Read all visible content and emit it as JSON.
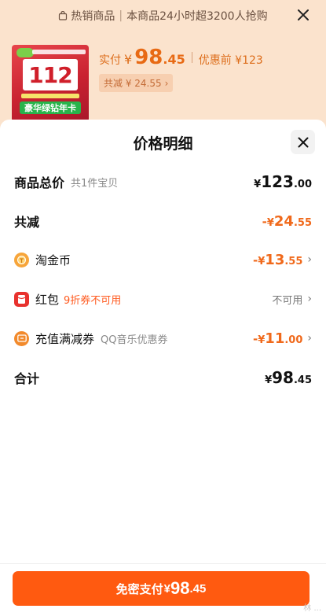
{
  "background": {
    "topbar": {
      "hot_label": "热销商品",
      "sep": "|",
      "notice": "本商品24小时超3200人抢购"
    },
    "product": {
      "thumb_number": "112",
      "thumb_caption": "豪华绿钻年卡",
      "paid_label": "实付",
      "paid_yen": "¥",
      "paid_int": "98",
      "paid_dec": ".45",
      "before_label": "优惠前 ¥123",
      "discount_chip": "共减 ¥ 24.55",
      "chip_chevron": "›"
    }
  },
  "sheet": {
    "title": "价格明细",
    "rows": {
      "total": {
        "name": "商品总价",
        "sub": "共1件宝贝",
        "yen": "¥",
        "int": "123",
        "dec": ".00"
      },
      "reduce": {
        "name": "共减",
        "sign": "-",
        "yen": "¥",
        "int": "24",
        "dec": ".55"
      },
      "coins": {
        "name": "淘金币",
        "sign": "-",
        "yen": "¥",
        "int": "13",
        "dec": ".55",
        "chevron": "›"
      },
      "redpacket": {
        "name": "红包",
        "sub": "9折券不可用",
        "status": "不可用",
        "chevron": "›"
      },
      "voucher": {
        "name": "充值满减券",
        "sub": "QQ音乐优惠券",
        "sign": "-",
        "yen": "¥",
        "int": "11",
        "dec": ".00",
        "chevron": "›"
      },
      "sum": {
        "name": "合计",
        "yen": "¥",
        "int": "98",
        "dec": ".45"
      }
    }
  },
  "pay_button": {
    "label": "免密支付",
    "yen": "¥",
    "int": "98",
    "dec": ".45"
  },
  "icons": {
    "close": "close-icon",
    "bag": "shopping-bag-icon",
    "coin": "coin-icon",
    "redpacket": "red-packet-icon",
    "voucher": "voucher-icon",
    "chevron": "chevron-right-icon"
  },
  "colors": {
    "accent": "#ff5a10",
    "discount_orange": "#f0691b",
    "coin_orange": "#f7a53a",
    "red_packet": "#e8322e"
  },
  "watermark": "林 ..."
}
